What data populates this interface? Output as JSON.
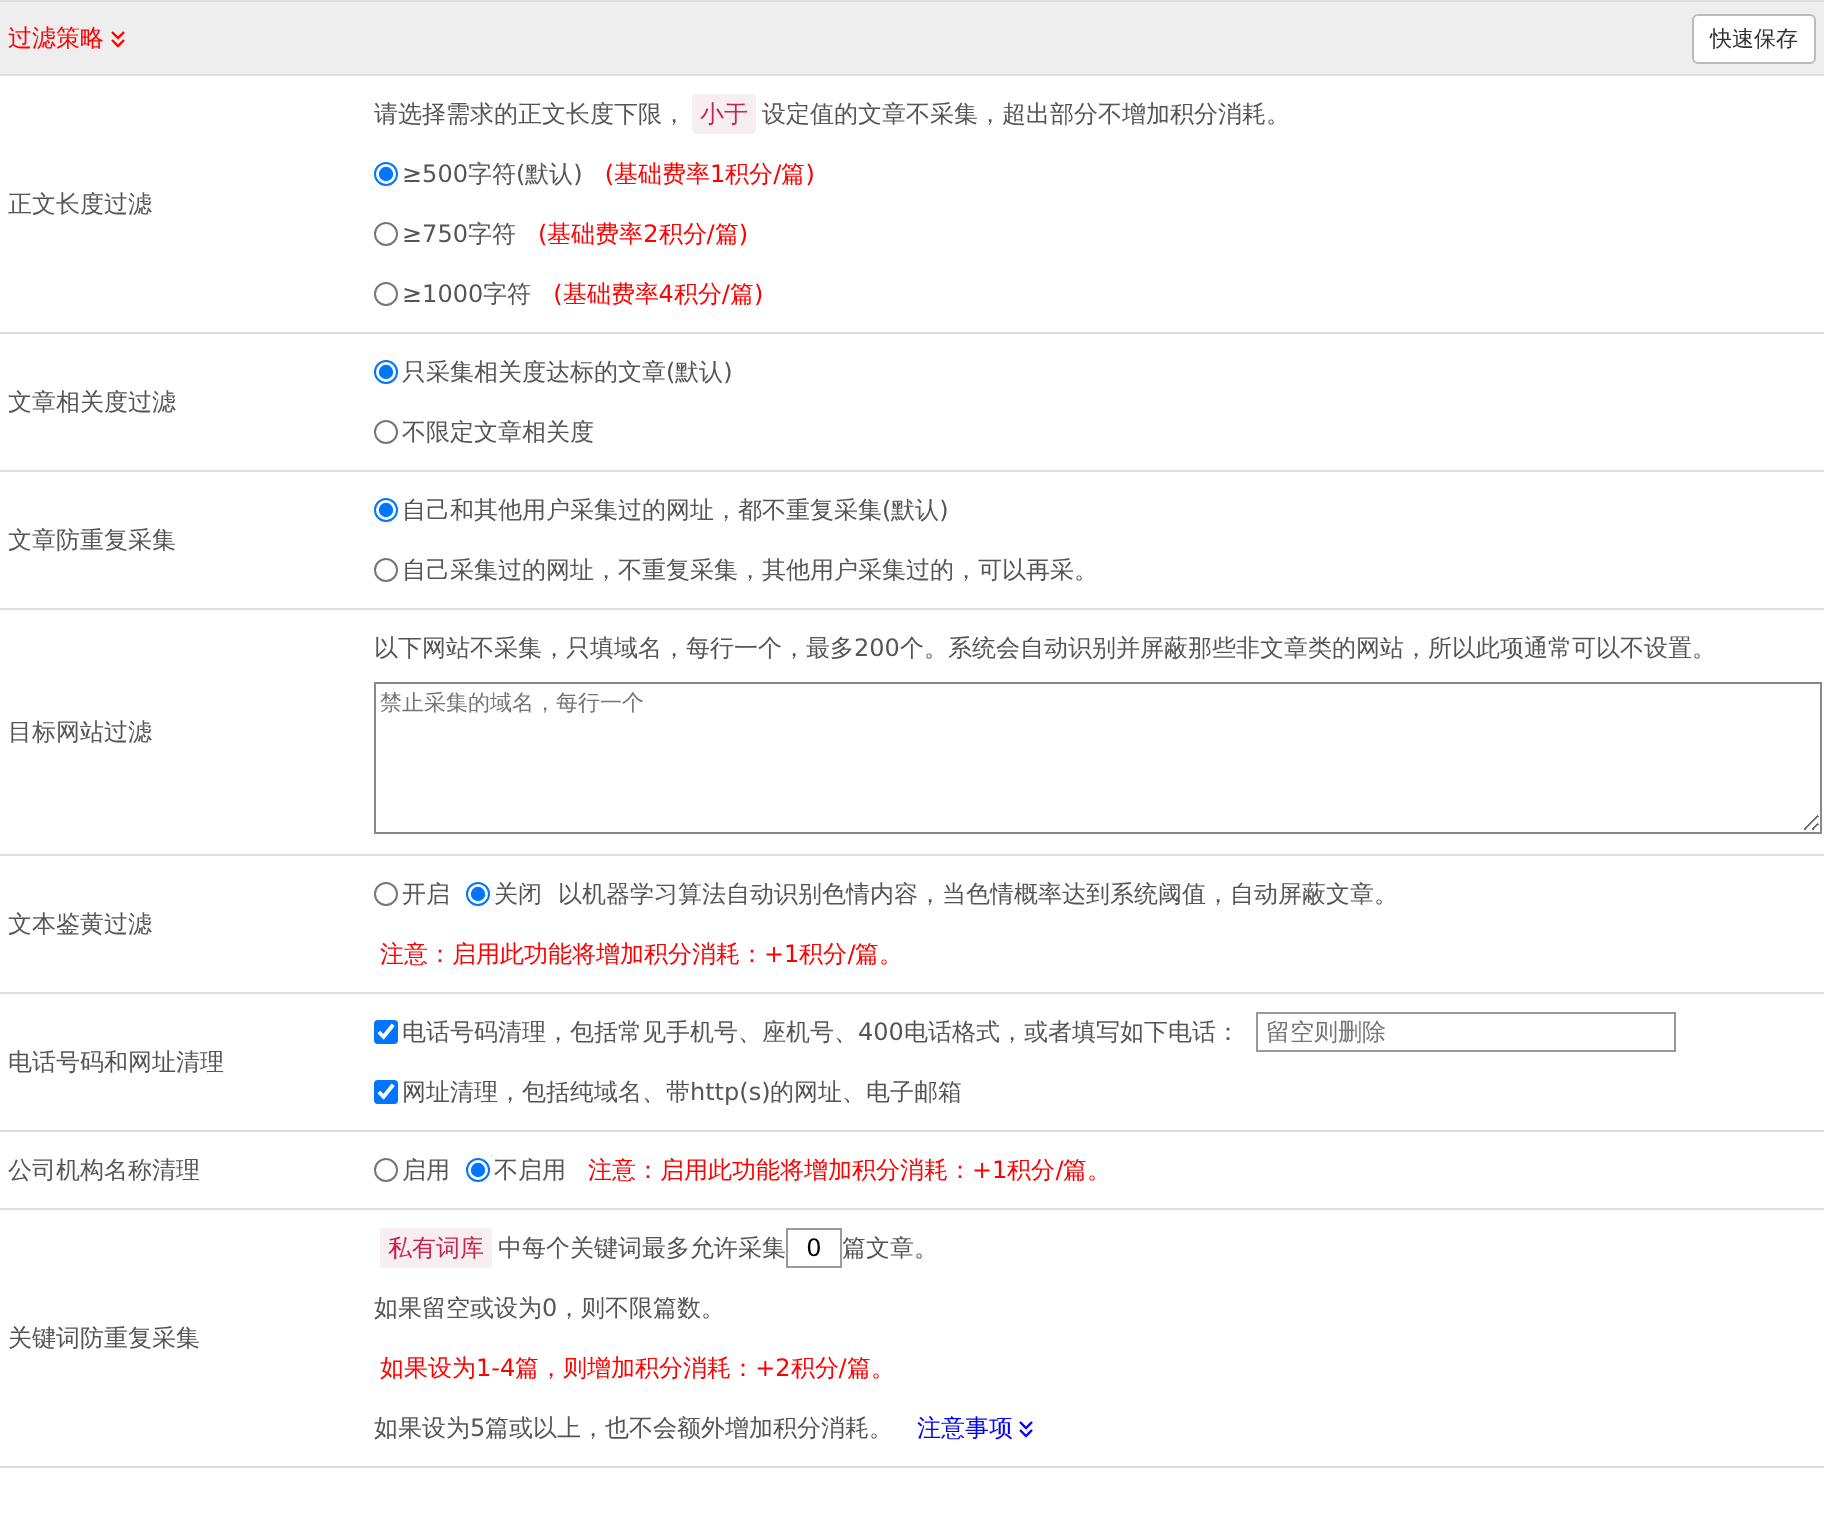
{
  "header": {
    "title": "过滤策略",
    "save_button": "快速保存"
  },
  "sections": [
    {
      "label": "正文长度过滤",
      "lines": [
        [
          {
            "kind": "text",
            "text": "请选择需求的正文长度下限，"
          },
          {
            "kind": "tag",
            "text": "小于"
          },
          {
            "kind": "text",
            "text": "设定值的文章不采集，超出部分不增加积分消耗。"
          }
        ],
        [
          {
            "kind": "radio",
            "text": "≥500字符(默认)",
            "selected": true
          },
          {
            "kind": "warn",
            "text": "(基础费率1积分/篇)"
          }
        ],
        [
          {
            "kind": "radio",
            "text": "≥750字符",
            "selected": false
          },
          {
            "kind": "warn",
            "text": "(基础费率2积分/篇)"
          }
        ],
        [
          {
            "kind": "radio",
            "text": "≥1000字符",
            "selected": false
          },
          {
            "kind": "warn",
            "text": "(基础费率4积分/篇)"
          }
        ]
      ]
    },
    {
      "label": "文章相关度过滤",
      "lines": [
        [
          {
            "kind": "radio",
            "text": "只采集相关度达标的文章(默认)",
            "selected": true
          }
        ],
        [
          {
            "kind": "radio",
            "text": "不限定文章相关度",
            "selected": false
          }
        ]
      ]
    },
    {
      "label": "文章防重复采集",
      "lines": [
        [
          {
            "kind": "radio",
            "text": "自己和其他用户采集过的网址，都不重复采集(默认)",
            "selected": true
          }
        ],
        [
          {
            "kind": "radio",
            "text": "自己采集过的网址，不重复采集，其他用户采集过的，可以再采。",
            "selected": false
          }
        ]
      ]
    },
    {
      "label": "目标网站过滤",
      "lines": [
        [
          {
            "kind": "text",
            "text": "以下网站不采集，只填域名，每行一个，最多200个。系统会自动识别并屏蔽那些非文章类的网站，所以此项通常可以不设置。"
          }
        ],
        [
          {
            "kind": "textarea",
            "placeholder": "禁止采集的域名，每行一个"
          }
        ]
      ]
    },
    {
      "label": "文本鉴黄过滤",
      "lines": [
        [
          {
            "kind": "radio",
            "text": "开启",
            "selected": false
          },
          {
            "kind": "radio",
            "text": "关闭",
            "selected": true
          },
          {
            "kind": "text",
            "text": "以机器学习算法自动识别色情内容，当色情概率达到系统阈值，自动屏蔽文章。"
          }
        ],
        [
          {
            "kind": "warn",
            "text": "注意：启用此功能将增加积分消耗：+1积分/篇。"
          }
        ]
      ]
    },
    {
      "label": "电话号码和网址清理",
      "lines": [
        [
          {
            "kind": "checkbox",
            "text": "电话号码清理，包括常见手机号、座机号、400电话格式，或者填写如下电话：",
            "checked": true
          },
          {
            "kind": "input",
            "placeholder": "留空则删除"
          }
        ],
        [
          {
            "kind": "checkbox",
            "text": "网址清理，包括纯域名、带http(s)的网址、电子邮箱",
            "checked": true
          }
        ]
      ]
    },
    {
      "label": "公司机构名称清理",
      "lines": [
        [
          {
            "kind": "radio",
            "text": "启用",
            "selected": false
          },
          {
            "kind": "radio",
            "text": "不启用",
            "selected": true
          },
          {
            "kind": "warn",
            "text": "注意：启用此功能将增加积分消耗：+1积分/篇。"
          }
        ]
      ]
    },
    {
      "label": "关键词防重复采集",
      "lines": [
        [
          {
            "kind": "tag",
            "text": "私有词库"
          },
          {
            "kind": "text",
            "text": "中每个关键词最多允许采集"
          },
          {
            "kind": "number",
            "value": "0"
          },
          {
            "kind": "text",
            "text": "篇文章。"
          }
        ],
        [
          {
            "kind": "text",
            "text": "如果留空或设为0，则不限篇数。"
          }
        ],
        [
          {
            "kind": "warn",
            "text": "如果设为1-4篇，则增加积分消耗：+2积分/篇。"
          }
        ],
        [
          {
            "kind": "text",
            "text": "如果设为5篇或以上，也不会额外增加积分消耗。"
          },
          {
            "kind": "link",
            "text": "注意事项"
          }
        ]
      ]
    }
  ]
}
